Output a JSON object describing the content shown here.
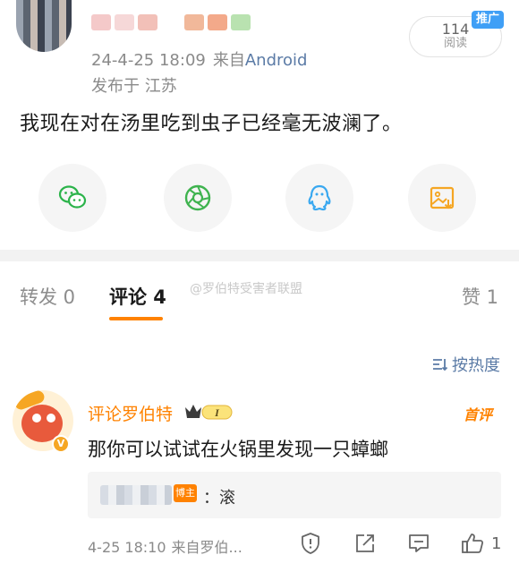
{
  "post": {
    "date": "24-4-25 18:09",
    "source_prefix": "来自",
    "source": "Android",
    "location": "发布于 江苏",
    "read_count": "114",
    "read_label": "阅读",
    "promo_badge": "推广",
    "text": "我现在对在汤里吃到虫子已经毫无波澜了。"
  },
  "share": {
    "items": [
      "wechat-icon",
      "moments-icon",
      "qq-icon",
      "save-image-icon"
    ],
    "colors": {
      "wechat": "#2bb34a",
      "moments": "#3fb34f",
      "qq": "#39a8f0",
      "save": "#f5a623"
    }
  },
  "tabs": {
    "repost": "转发 0",
    "comment": "评论 4",
    "like": "赞 1",
    "accent": "#ff8200"
  },
  "watermark": "@罗伯特受害者联盟",
  "sort_label": "按热度",
  "comment": {
    "author": "评论罗伯特",
    "level_badge": "I",
    "first_badge": "首评",
    "text": "那你可以试试在火锅里发现一只蟑螂",
    "reply_op_badge": "博主",
    "reply_text": "：滚",
    "time": "4-25 18:10",
    "source": "来自罗伯...",
    "like_count": "1"
  }
}
